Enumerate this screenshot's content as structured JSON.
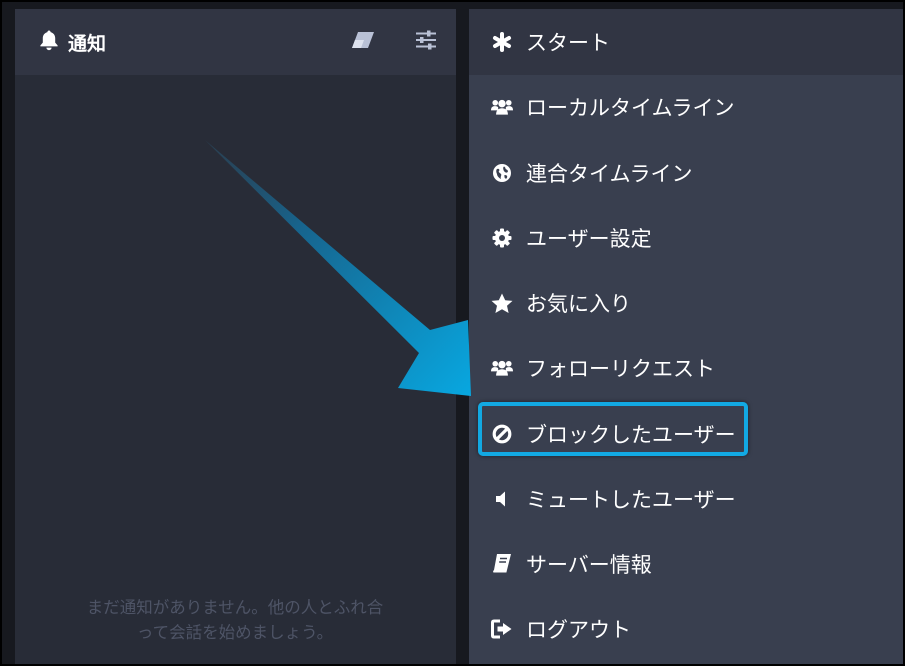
{
  "notifications": {
    "title": "通知",
    "icon": "bell-icon",
    "clear_icon": "eraser-icon",
    "settings_icon": "sliders-icon",
    "empty_message_line1": "まだ通知がありません。他の人とふれ合",
    "empty_message_line2": "って会話を始めましょう。"
  },
  "menu": {
    "items": [
      {
        "label": "スタート",
        "icon": "asterisk-icon"
      },
      {
        "label": "ローカルタイムライン",
        "icon": "users-icon"
      },
      {
        "label": "連合タイムライン",
        "icon": "globe-icon"
      },
      {
        "label": "ユーザー設定",
        "icon": "gear-icon"
      },
      {
        "label": "お気に入り",
        "icon": "star-icon"
      },
      {
        "label": "フォローリクエスト",
        "icon": "users-icon"
      },
      {
        "label": "ブロックしたユーザー",
        "icon": "ban-icon"
      },
      {
        "label": "ミュートしたユーザー",
        "icon": "volume-off-icon"
      },
      {
        "label": "サーバー情報",
        "icon": "book-icon"
      },
      {
        "label": "ログアウト",
        "icon": "sign-out-icon"
      }
    ]
  },
  "colors": {
    "background": "#17191f",
    "column": "#282c37",
    "header": "#313543",
    "menu": "#393f4f",
    "highlight": "#12a9e3",
    "muted_text": "#4e5466"
  }
}
